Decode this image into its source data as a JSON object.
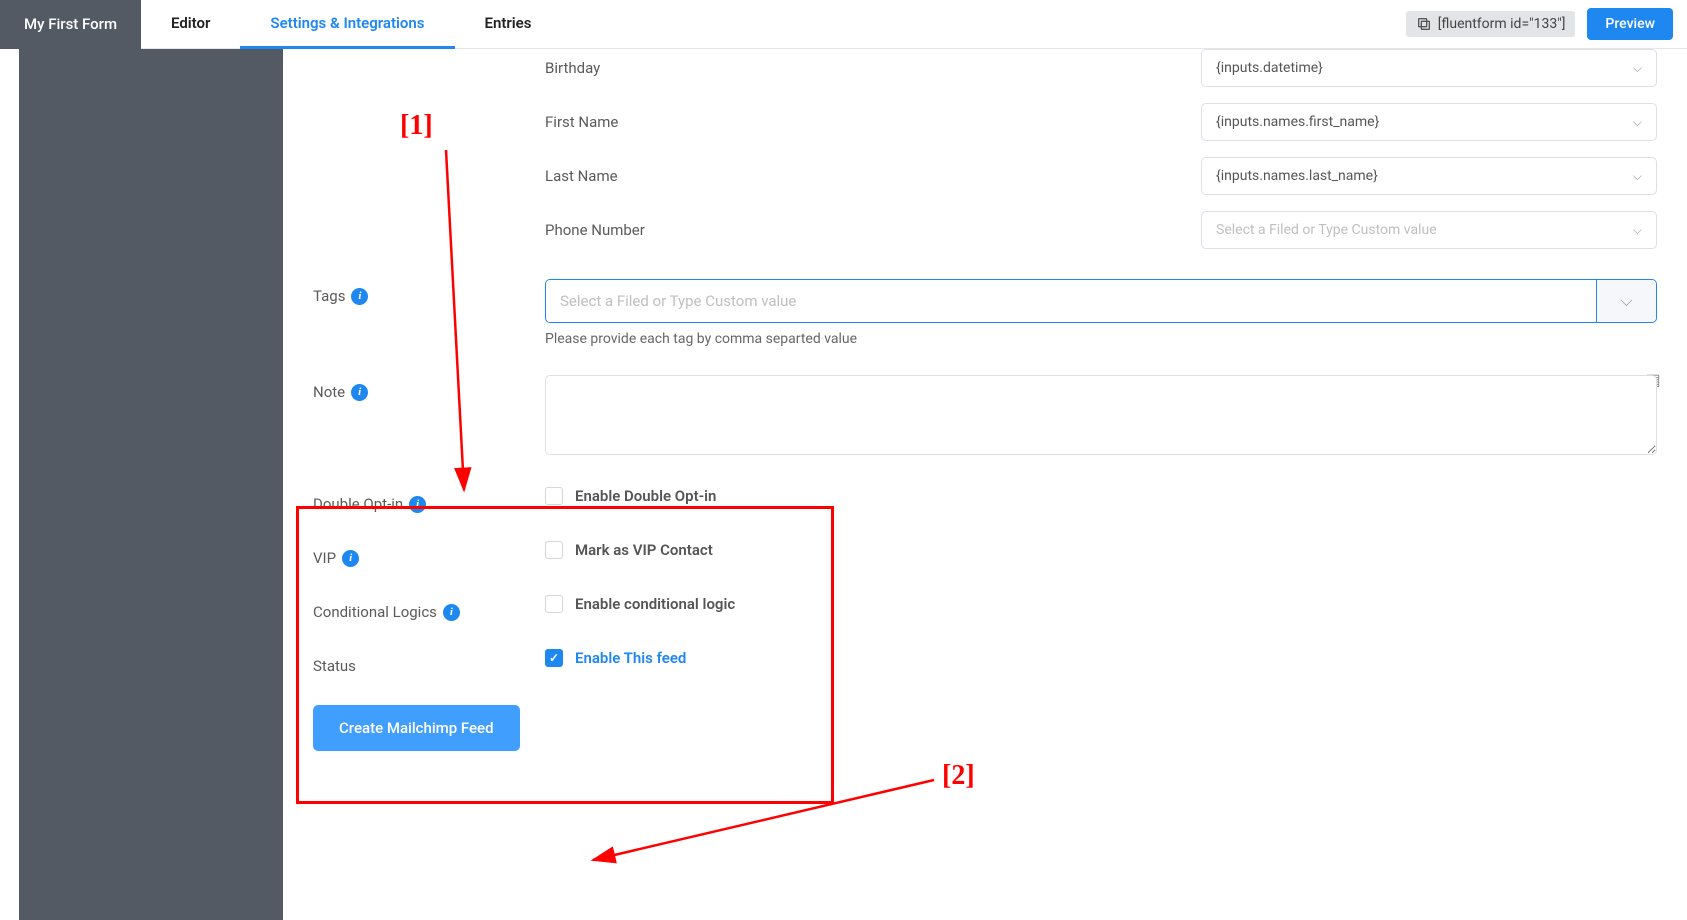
{
  "topbar": {
    "brand": "My First Form",
    "tabs": {
      "editor": "Editor",
      "settings": "Settings & Integrations",
      "entries": "Entries"
    },
    "shortcode": "[fluentform id=\"133\"]",
    "preview": "Preview"
  },
  "map_fields": {
    "birthday": {
      "label": "Birthday",
      "value": "{inputs.datetime}"
    },
    "first_name": {
      "label": "First Name",
      "value": "{inputs.names.first_name}"
    },
    "last_name": {
      "label": "Last Name",
      "value": "{inputs.names.last_name}"
    },
    "phone": {
      "label": "Phone Number",
      "placeholder": "Select a Filed or Type Custom value"
    }
  },
  "tags": {
    "label": "Tags",
    "placeholder": "Select a Filed or Type Custom value",
    "help": "Please provide each tag by comma separted value"
  },
  "note": {
    "label": "Note"
  },
  "double_optin": {
    "label": "Double Opt-in",
    "checkbox": "Enable Double Opt-in"
  },
  "vip": {
    "label": "VIP",
    "checkbox": "Mark as VIP Contact"
  },
  "conditional": {
    "label": "Conditional Logics",
    "checkbox": "Enable conditional logic"
  },
  "status": {
    "label": "Status",
    "checkbox": "Enable This feed"
  },
  "submit": "Create Mailchimp Feed",
  "annotations": {
    "one": "[1]",
    "two": "[2]"
  }
}
